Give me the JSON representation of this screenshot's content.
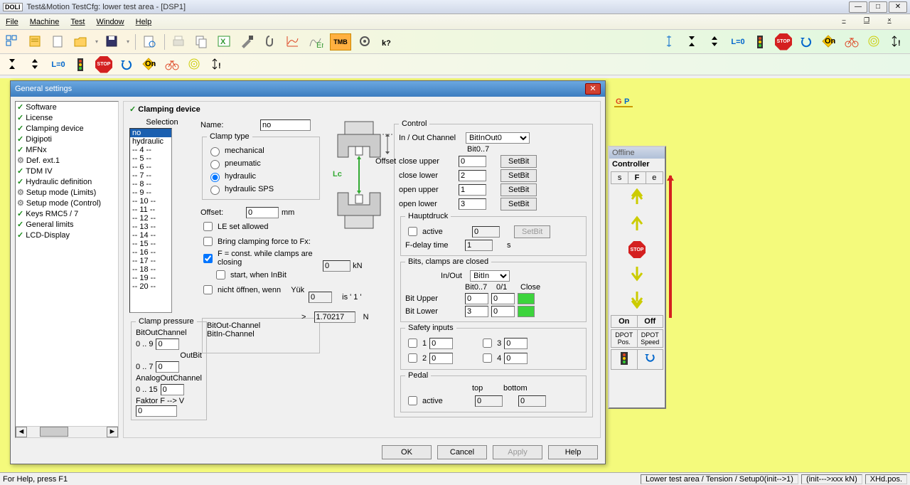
{
  "title": "Test&Motion   TestCfg: lower test area - [DSP1]",
  "menu": {
    "file": "File",
    "machine": "Machine",
    "test": "Test",
    "window": "Window",
    "help": "Help"
  },
  "dialog": {
    "title": "General settings",
    "tree": [
      "Software",
      "License",
      "Clamping device",
      "Digipoti",
      "MFNx",
      "Def. ext.1",
      "TDM IV",
      "Hydraulic definition",
      "Setup mode (Limits)",
      "Setup mode (Control)",
      "Keys RMC5 / 7",
      "General limits",
      "LCD-Display"
    ],
    "panel_title": "Clamping device",
    "selection_label": "Selection",
    "list": [
      "no",
      "hydraulic",
      "-- 4 --",
      "-- 5 --",
      "-- 6 --",
      "-- 7 --",
      "-- 8 --",
      "-- 9 --",
      "-- 10 --",
      "-- 11 --",
      "-- 12 --",
      "-- 13 --",
      "-- 14 --",
      "-- 15 --",
      "-- 16 --",
      "-- 17 --",
      "-- 18 --",
      "-- 19 --",
      "-- 20 --"
    ],
    "name_label": "Name:",
    "name_value": "no",
    "clamp_type_legend": "Clamp type",
    "clamp_types": {
      "mechanical": "mechanical",
      "pneumatic": "pneumatic",
      "hydraulic": "hydraulic",
      "hydraulic_sps": "hydraulic SPS"
    },
    "offset_label": "Offset:",
    "offset_value": "0",
    "offset_unit": "mm",
    "le_set": "LE set allowed",
    "bring_force": "Bring clamping force to Fx:",
    "bring_force_value": "0",
    "bring_force_unit": "kN",
    "f_const": "F = const. while clamps are closing",
    "start_inbit": "start, when InBit",
    "start_inbit_value": "0",
    "start_inbit_is": "is ' 1 '",
    "nicht_offnen": "nicht öffnen, wenn",
    "yuk": "Yük",
    "gt": ">",
    "yuk_value": "1.70217",
    "yuk_unit": "N",
    "clamp_pressure_legend": "Clamp pressure",
    "bitout_channel_label": "BitOutChannel",
    "range_09": "0 .. 9",
    "bitout_channel_value": "0",
    "outbit_label": "OutBit",
    "range_07": "0 .. 7",
    "outbit_value": "0",
    "analog_channel_label": "AnalogOutChannel",
    "range_015": "0 .. 15",
    "analog_channel_value": "0",
    "faktor_label": "Faktor  F --> V",
    "faktor_value": "0",
    "bitout_info": "BitOut-Channel",
    "bitin_info": "BitIn-Channel",
    "diagram_lc": "Lc",
    "diagram_offset": "Offset",
    "control_legend": "Control",
    "inout_channel_label": "In / Out Channel",
    "inout_channel_value": "BitInOut0",
    "bit07": "Bit0..7",
    "close_upper": "close upper",
    "close_upper_v": "0",
    "close_lower": "close lower",
    "close_lower_v": "2",
    "open_upper": "open upper",
    "open_upper_v": "1",
    "open_lower": "open lower",
    "open_lower_v": "3",
    "setbit": "SetBit",
    "hauptdruck_legend": "Hauptdruck",
    "active": "active",
    "hauptdruck_v": "0",
    "fdelay": "F-delay time",
    "fdelay_v": "1",
    "fdelay_unit": "s",
    "bits_closed_legend": "Bits, clamps are closed",
    "inout_label": "In/Out",
    "inout_value": "BitIn",
    "col_bit07": "Bit0..7",
    "col_01": "0/1",
    "col_close": "Close",
    "bit_upper": "Bit Upper",
    "bit_upper_v": "0",
    "bit_upper_01": "0",
    "bit_lower": "Bit Lower",
    "bit_lower_v": "3",
    "bit_lower_01": "0",
    "safety_legend": "Safety inputs",
    "si1": "1",
    "si1_v": "0",
    "si2": "2",
    "si2_v": "0",
    "si3": "3",
    "si3_v": "0",
    "si4": "4",
    "si4_v": "0",
    "pedal_legend": "Pedal",
    "pedal_active": "active",
    "pedal_top": "top",
    "pedal_top_v": "0",
    "pedal_bottom": "bottom",
    "pedal_bottom_v": "0",
    "ok": "OK",
    "cancel": "Cancel",
    "apply": "Apply",
    "help": "Help"
  },
  "floater": {
    "offline": "Offline",
    "controller": "Controller",
    "s": "s",
    "f": "F",
    "e": "e",
    "on": "On",
    "off": "Off",
    "dpot_pos": "DPOT Pos.",
    "dpot_speed": "DPOT Speed",
    "stop": "STOP"
  },
  "status": {
    "help": "For Help, press F1",
    "seg1": "Lower test area / Tension / Setup0(init-->1)",
    "seg2": "(init--->xxx kN)",
    "seg3": "XHd.pos."
  },
  "toolbar2": {
    "l0": "L=0",
    "stop": "STOP",
    "on": "On"
  },
  "toolbar1": {
    "tmb": "TMB",
    "l0": "L=0",
    "stop": "STOP",
    "on": "On"
  }
}
